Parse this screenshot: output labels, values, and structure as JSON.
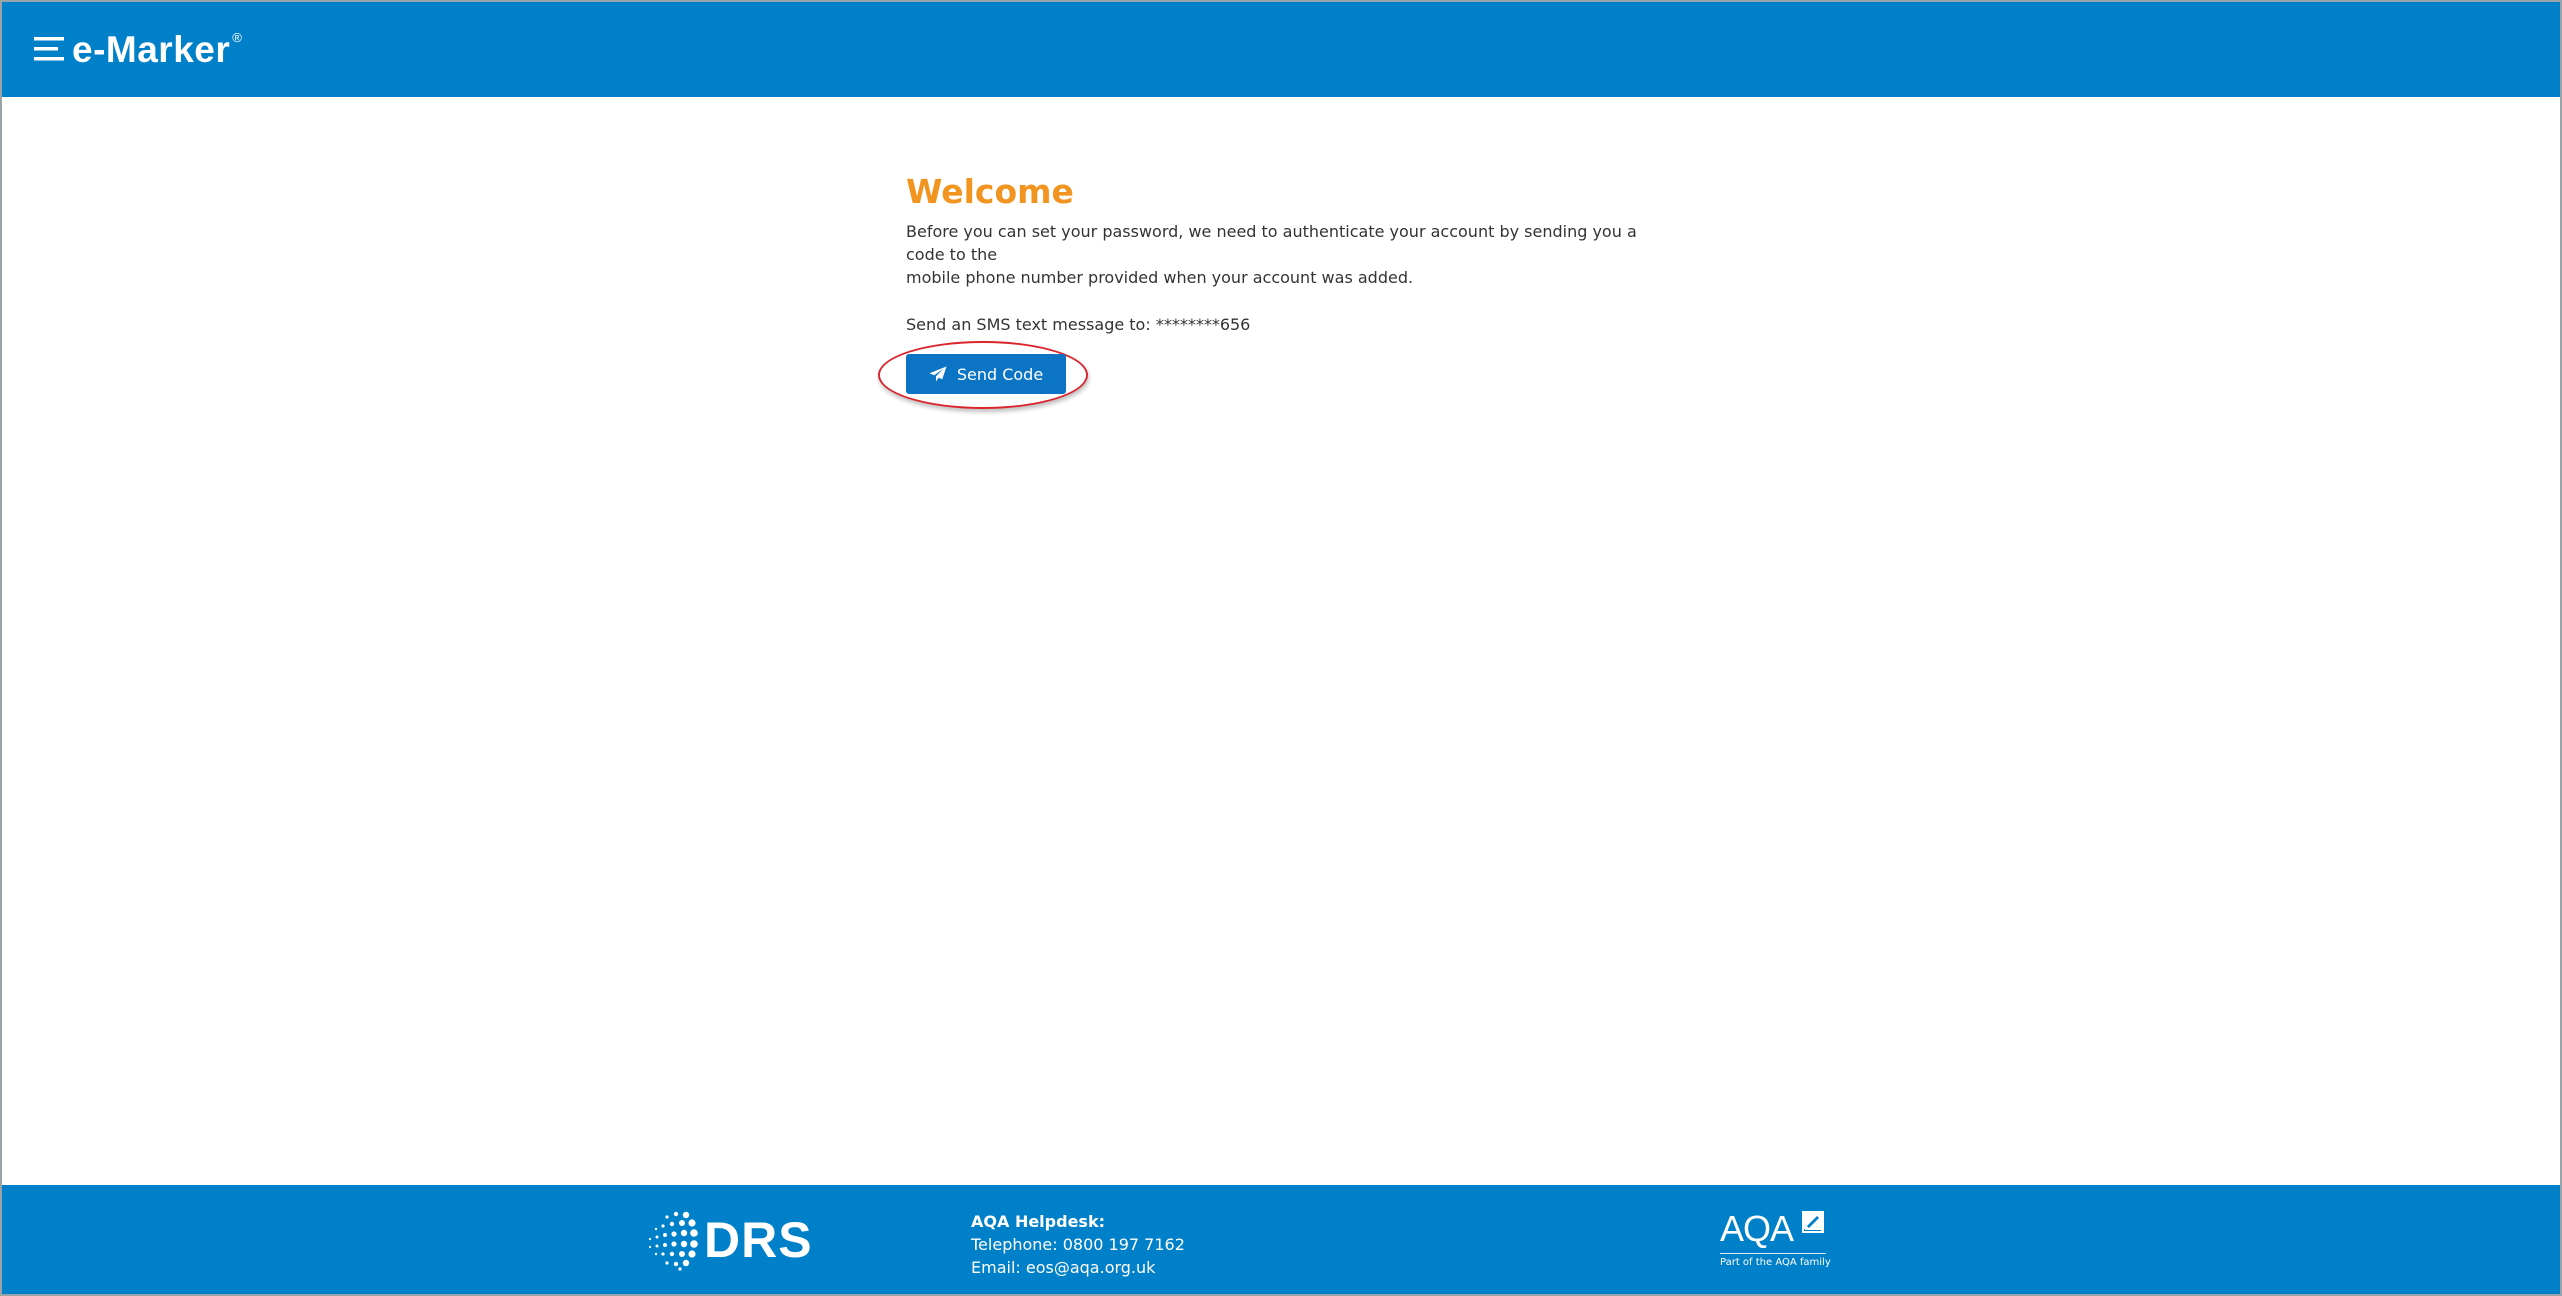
{
  "header": {
    "logo_text": "e-Marker",
    "logo_reg": "®",
    "color": "#0080c9"
  },
  "main": {
    "title": "Welcome",
    "title_color": "#f29420",
    "intro_line_1": "Before you can set your password, we need to authenticate your account by sending you a code to the",
    "intro_line_2": "mobile phone number provided when your account was added.",
    "sms_label": "Send an SMS text message to: ********656",
    "send_button": {
      "label": "Send Code",
      "icon": "paper-plane-icon",
      "color": "#0b74c4"
    },
    "highlight_color": "#d9262c"
  },
  "footer": {
    "drs_logo_text": "DRS",
    "helpdesk_title": "AQA Helpdesk:",
    "telephone": "Telephone: 0800 197 7162",
    "email": "Email: eos@aqa.org.uk",
    "aqa_logo_text": "AQA",
    "aqa_tagline": "Part of the AQA family"
  }
}
